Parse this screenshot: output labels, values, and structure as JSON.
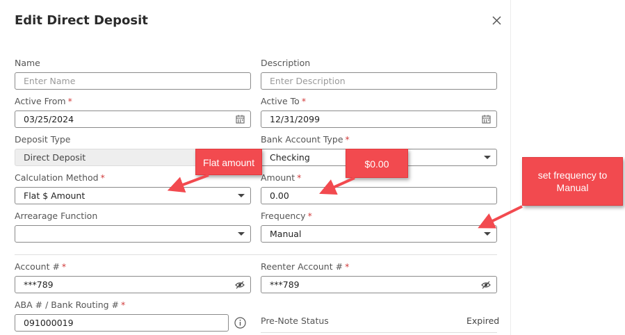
{
  "dialog": {
    "title": "Edit Direct Deposit"
  },
  "icons": {
    "close": "close-icon",
    "calendar": "calendar-icon",
    "dropdown": "chevron-down-icon",
    "eye": "eye-slash-icon",
    "info": "info-icon"
  },
  "fields": {
    "name": {
      "label": "Name",
      "placeholder": "Enter Name"
    },
    "description": {
      "label": "Description",
      "placeholder": "Enter Description"
    },
    "active_from": {
      "label": "Active From",
      "value": "03/25/2024",
      "required": "*"
    },
    "active_to": {
      "label": "Active To",
      "value": "12/31/2099",
      "required": "*"
    },
    "deposit_type": {
      "label": "Deposit Type",
      "value": "Direct Deposit"
    },
    "bank_account_type": {
      "label": "Bank Account Type",
      "value": "Checking",
      "required": "*"
    },
    "calculation_method": {
      "label": "Calculation Method",
      "value": "Flat $ Amount",
      "required": "*"
    },
    "amount": {
      "label": "Amount",
      "value": "0.00",
      "required": "*"
    },
    "arrearage_function": {
      "label": "Arrearage Function",
      "value": ""
    },
    "frequency": {
      "label": "Frequency",
      "value": "Manual",
      "required": "*"
    },
    "account_number": {
      "label": "Account #",
      "value": "***789",
      "required": "*"
    },
    "reenter_account_number": {
      "label": "Reenter Account #",
      "value": "***789",
      "required": "*"
    },
    "aba_routing": {
      "label": "ABA # / Bank Routing #",
      "value": "091000019",
      "required": "*"
    },
    "pre_note_status": {
      "label": "Pre-Note Status",
      "value": "Expired"
    }
  },
  "annotations": {
    "flat_amount": "Flat amount",
    "amount_value": "$0.00",
    "frequency_line1": "set frequency to",
    "frequency_line2": "Manual",
    "color": "#f24a4f"
  }
}
